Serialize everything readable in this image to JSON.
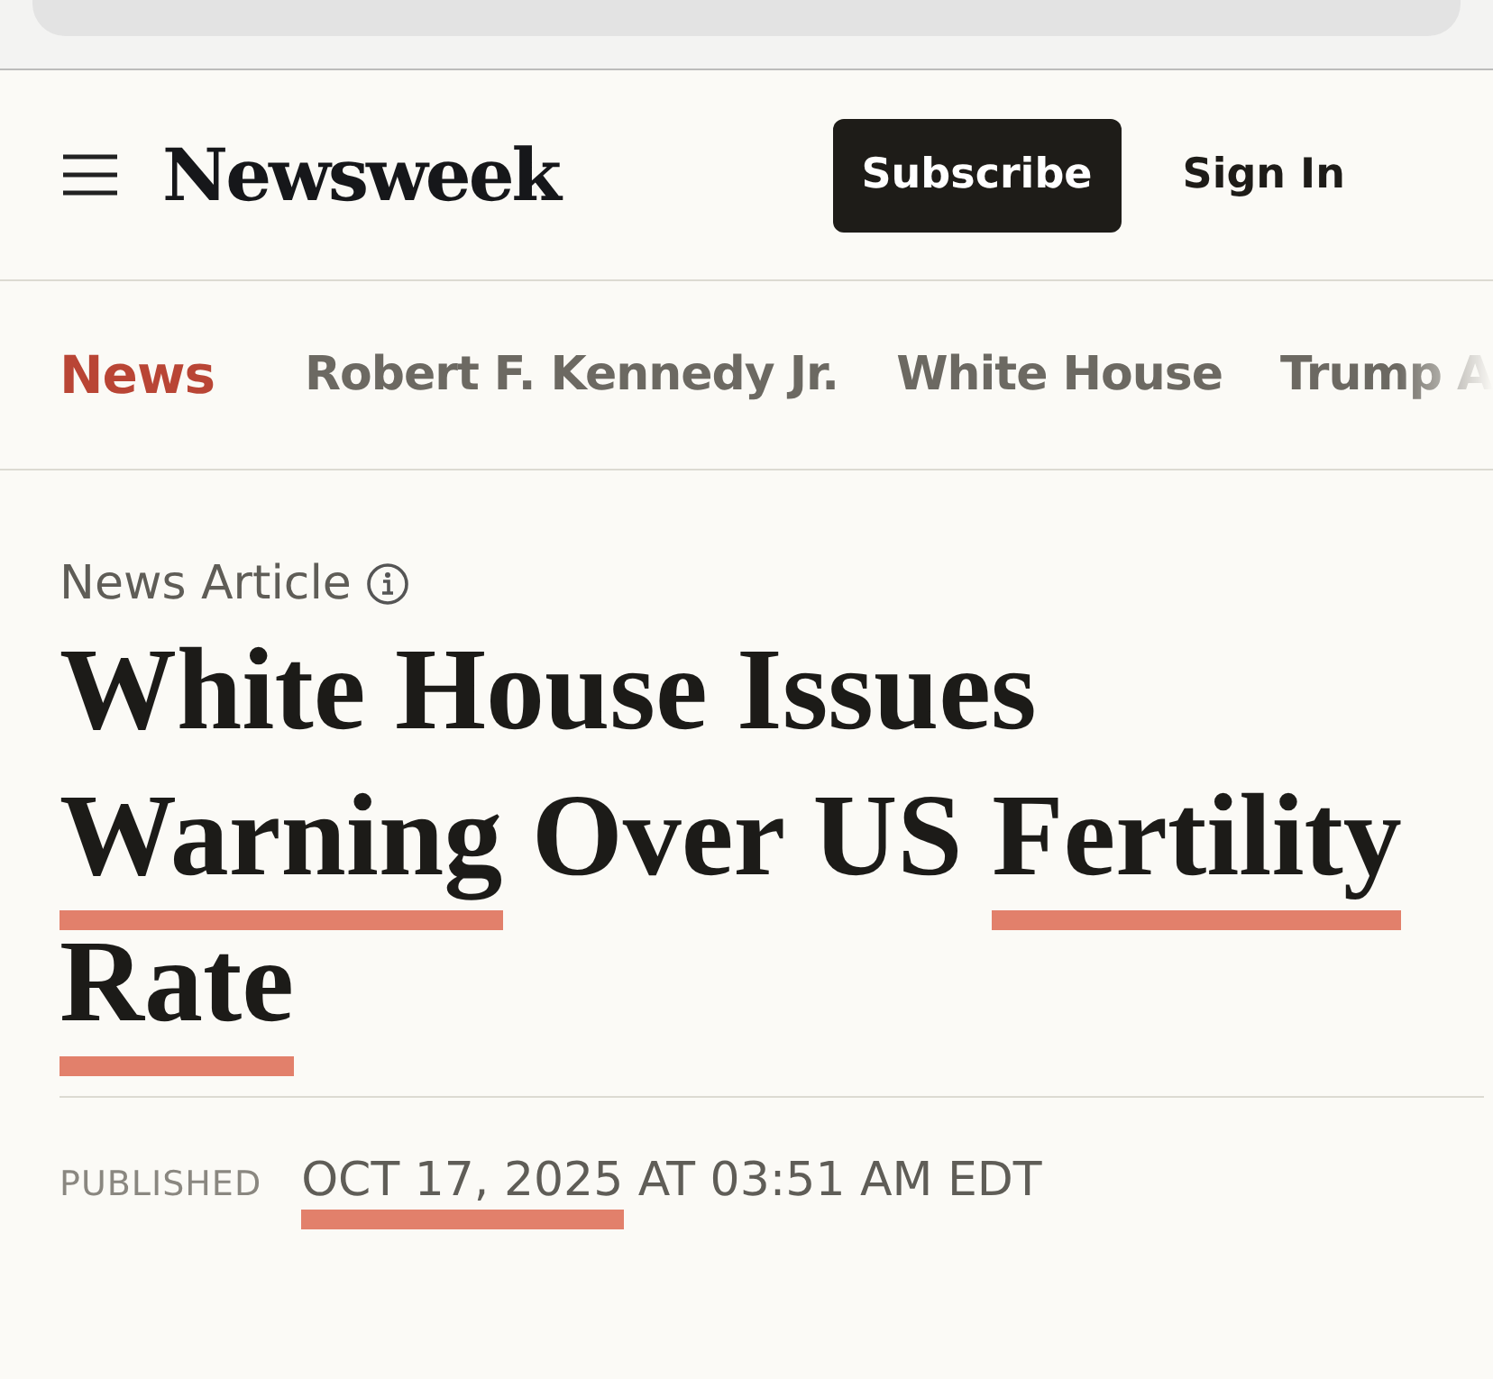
{
  "header": {
    "logo": "Newsweek",
    "subscribe": "Subscribe",
    "sign_in": "Sign In"
  },
  "nav": [
    {
      "label": "News",
      "selected": true
    },
    {
      "label": "Robert F. Kennedy Jr.",
      "selected": false
    },
    {
      "label": "White House",
      "selected": false
    },
    {
      "label": "Trump A",
      "selected": false
    }
  ],
  "article": {
    "label": "News Article",
    "headline": [
      {
        "text": "White House Issues",
        "marked": false
      },
      {
        "text": "Warning",
        "marked": true
      },
      {
        "text": "Over US",
        "marked": false
      },
      {
        "text": "Fertility",
        "marked": true
      },
      {
        "text": "Rate",
        "marked": true
      }
    ],
    "published_label": "PUBLISHED",
    "date": [
      {
        "text": "OCT 17, 2025",
        "marked": true
      },
      {
        "text": "AT 03:51 AM EDT",
        "marked": false
      }
    ]
  }
}
